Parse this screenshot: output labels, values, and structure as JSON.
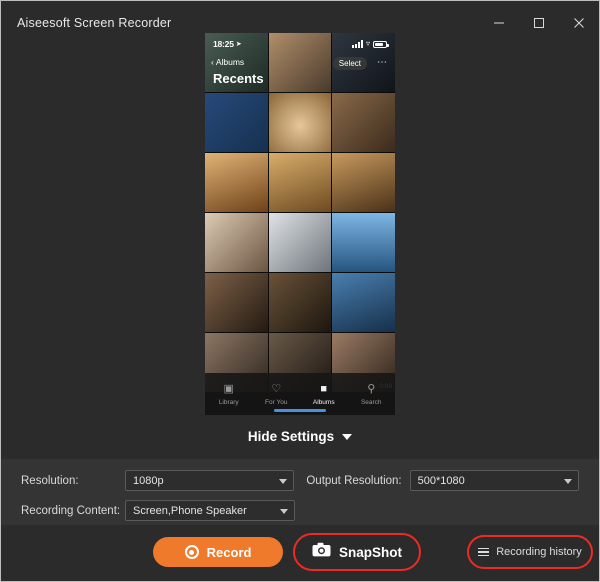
{
  "window": {
    "title": "Aiseesoft Screen Recorder",
    "controls": {
      "minimize": "minimize-icon",
      "maximize": "maximize-icon",
      "close": "close-icon"
    }
  },
  "preview": {
    "device_status": {
      "time": "18:25",
      "location_icon": "location-arrow-icon",
      "signal_icon": "cellular-bars-icon",
      "wifi_icon": "wifi-icon",
      "battery_icon": "battery-icon"
    },
    "nav": {
      "back_label": "Albums",
      "back_icon": "chevron-left-icon",
      "title": "Recents",
      "select_label": "Select",
      "more_icon": "ellipsis-icon"
    },
    "grid": {
      "video_duration": "0:09",
      "cells": [
        {
          "name": "photo-thumb-1",
          "c1": "#4a5d52",
          "c2": "#1d2a26"
        },
        {
          "name": "photo-thumb-2",
          "c1": "#b08f6a",
          "c2": "#4a3a2c"
        },
        {
          "name": "photo-thumb-3",
          "c1": "#2f3640",
          "c2": "#11151a"
        },
        {
          "name": "photo-thumb-4",
          "c1": "#274a7a",
          "c2": "#16304f"
        },
        {
          "name": "photo-thumb-5",
          "c1": "#c7a06a",
          "c2": "#6a4e30"
        },
        {
          "name": "photo-thumb-6",
          "c1": "#8a6a4a",
          "c2": "#3b2b1c"
        },
        {
          "name": "photo-thumb-7",
          "c1": "#d3a05a",
          "c2": "#7a4f22"
        },
        {
          "name": "photo-thumb-8",
          "c1": "#caa05e",
          "c2": "#6e4a20"
        },
        {
          "name": "photo-thumb-9",
          "c1": "#b98a52",
          "c2": "#5e3d1c"
        },
        {
          "name": "photo-thumb-10",
          "c1": "#c8b39a",
          "c2": "#6b5542"
        },
        {
          "name": "photo-thumb-11",
          "c1": "#c9cdd2",
          "c2": "#6e747a"
        },
        {
          "name": "photo-thumb-12",
          "c1": "#6fa8d8",
          "c2": "#2a5f8f"
        },
        {
          "name": "photo-thumb-13",
          "c1": "#6b5340",
          "c2": "#2b2018"
        },
        {
          "name": "photo-thumb-14",
          "c1": "#5a4634",
          "c2": "#241b14"
        },
        {
          "name": "photo-thumb-15",
          "c1": "#3f6f9e",
          "c2": "#16304a"
        },
        {
          "name": "photo-thumb-16",
          "c1": "#7e6a58",
          "c2": "#2e261f"
        },
        {
          "name": "photo-thumb-17",
          "c1": "#6a5a48",
          "c2": "#241e18"
        },
        {
          "name": "photo-thumb-18",
          "c1": "#8c6f5a",
          "c2": "#34271f"
        }
      ]
    },
    "tabs": [
      {
        "label": "Library",
        "icon": "library-icon",
        "active": false
      },
      {
        "label": "For You",
        "icon": "heart-icon",
        "active": false
      },
      {
        "label": "Albums",
        "icon": "albums-icon",
        "active": true
      },
      {
        "label": "Search",
        "icon": "search-icon",
        "active": false
      }
    ]
  },
  "hide_settings": {
    "label": "Hide Settings",
    "icon": "chevron-down-icon"
  },
  "settings": {
    "resolution_label": "Resolution:",
    "resolution_value": "1080p",
    "output_resolution_label": "Output Resolution:",
    "output_resolution_value": "500*1080",
    "recording_content_label": "Recording Content:",
    "recording_content_value": "Screen,Phone Speaker"
  },
  "actions": {
    "record_label": "Record",
    "record_icon": "record-dot-icon",
    "snapshot_label": "SnapShot",
    "snapshot_icon": "camera-icon",
    "history_label": "Recording history",
    "history_icon": "list-icon"
  },
  "colors": {
    "accent_orange": "#ef7a2b",
    "highlight_red": "#ee2a24",
    "panel": "#343434",
    "background": "#2b2b2b",
    "tab_active_blue": "#4a90e2"
  }
}
